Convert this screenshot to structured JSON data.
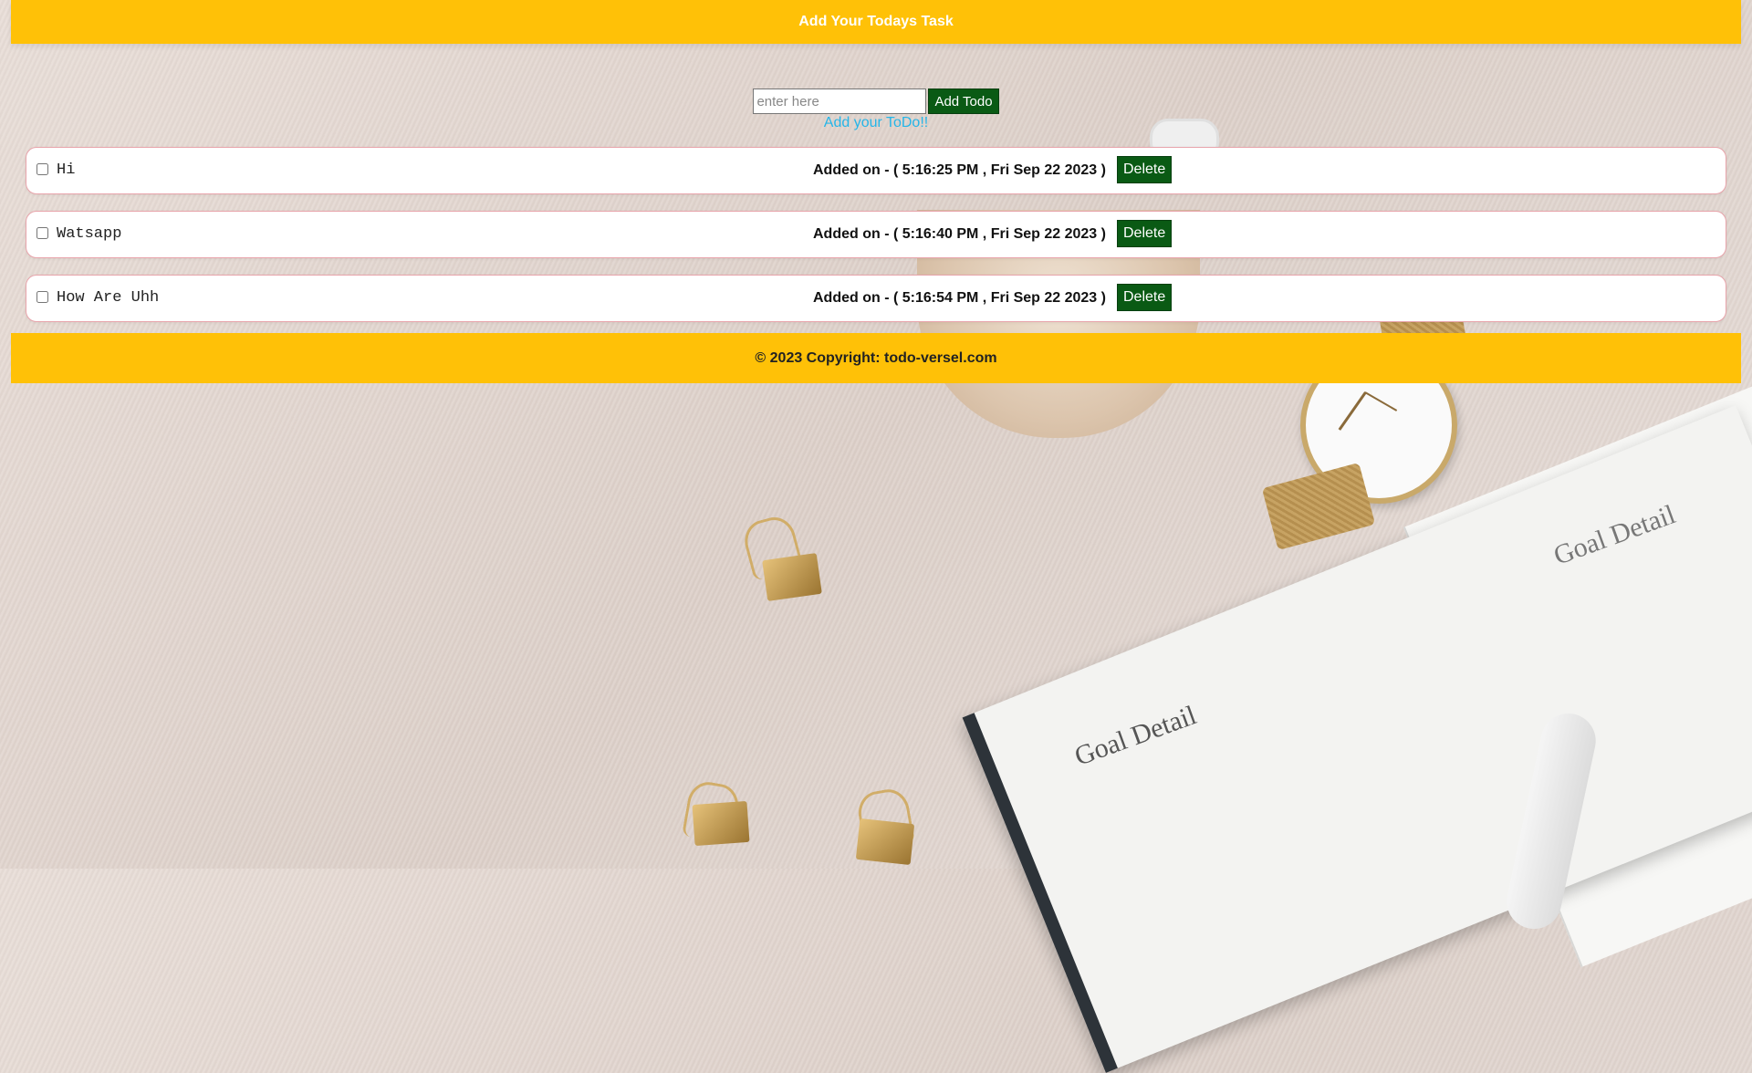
{
  "header": {
    "title": "Add Your Todays Task"
  },
  "form": {
    "placeholder": "enter here",
    "value": "",
    "add_label": "Add Todo",
    "hint": "Add your ToDo!!"
  },
  "todos": [
    {
      "text": "Hi",
      "added_on": "Added on - ( 5:16:25 PM , Fri Sep 22 2023 )",
      "delete_label": "Delete",
      "checked": false
    },
    {
      "text": "Watsapp",
      "added_on": "Added on - ( 5:16:40 PM , Fri Sep 22 2023 )",
      "delete_label": "Delete",
      "checked": false
    },
    {
      "text": "How Are Uhh",
      "added_on": "Added on - ( 5:16:54 PM , Fri Sep 22 2023 )",
      "delete_label": "Delete",
      "checked": false
    }
  ],
  "footer": {
    "text": "© 2023 Copyright: todo-versel.com"
  },
  "colors": {
    "header_bg": "#ffc107",
    "button_bg": "#0a5a14",
    "hint": "#25b5e8",
    "item_border": "#e8a4ab"
  },
  "background_image": {
    "printed_text": [
      "Goal Detail",
      "Goal Detail"
    ]
  }
}
